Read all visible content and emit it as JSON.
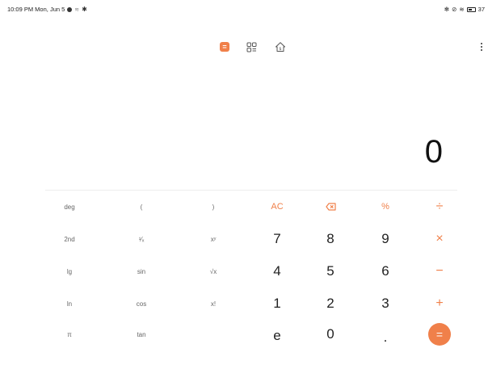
{
  "status_bar": {
    "time_date": "10:09 PM Mon, Jun 5",
    "battery": "37"
  },
  "toolbar": {
    "calculator_mode_icon": "calculator-icon",
    "converter_mode_icon": "grid-list-icon",
    "finance_mode_icon": "house-dollar-icon",
    "more_icon": "more-vertical-icon",
    "accent_color": "#f0804a"
  },
  "display": {
    "value": "0"
  },
  "keypad": {
    "row1": [
      "deg",
      "(",
      ")",
      "AC",
      "⌫",
      "%",
      "÷"
    ],
    "row2": [
      "2nd",
      "¹⁄ₓ",
      "xʸ",
      "7",
      "8",
      "9",
      "×"
    ],
    "row3": [
      "lg",
      "sin",
      "√x",
      "4",
      "5",
      "6",
      "−"
    ],
    "row4": [
      "ln",
      "cos",
      "x!",
      "1",
      "2",
      "3",
      "+"
    ],
    "row5": [
      "π",
      "tan",
      "e",
      "0",
      ".",
      "="
    ]
  }
}
